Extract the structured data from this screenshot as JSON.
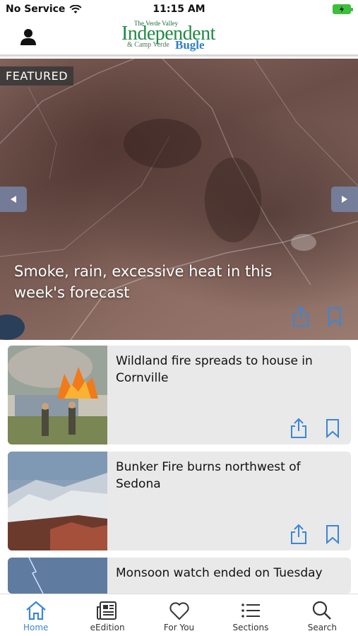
{
  "status_bar": {
    "carrier": "No Service",
    "time": "11:15 AM"
  },
  "header": {
    "logo": {
      "the": "The Verde Valley",
      "main": "Independent",
      "sub": "& Camp Verde",
      "bugle": "Bugle"
    }
  },
  "featured": {
    "badge": "FEATURED",
    "title": "Smoke, rain, excessive heat in this week's forecast"
  },
  "articles": [
    {
      "title": "Wildland fire spreads to house in Cornville"
    },
    {
      "title": "Bunker Fire burns northwest of Sedona"
    },
    {
      "title": "Monsoon watch ended on Tuesday"
    }
  ],
  "tabs": [
    {
      "label": "Home",
      "icon": "home-icon",
      "active": true
    },
    {
      "label": "eEdition",
      "icon": "newspaper-icon",
      "active": false
    },
    {
      "label": "For You",
      "icon": "heart-icon",
      "active": false
    },
    {
      "label": "Sections",
      "icon": "list-icon",
      "active": false
    },
    {
      "label": "Search",
      "icon": "search-icon",
      "active": false
    }
  ],
  "colors": {
    "accent": "#3a86d9",
    "logo_green": "#1f8a43",
    "battery": "#3cbf3c"
  }
}
